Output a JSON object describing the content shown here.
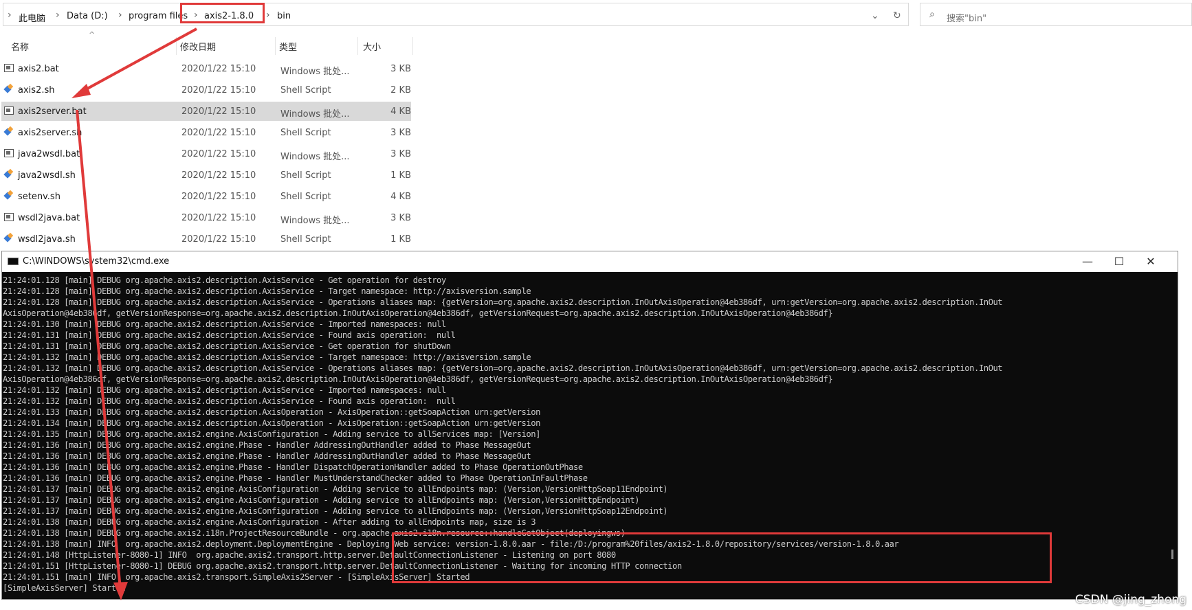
{
  "explorer": {
    "breadcrumb": [
      "此电脑",
      "Data (D:)",
      "program files",
      "axis2-1.8.0",
      "bin"
    ],
    "search_placeholder": "搜索\"bin\"",
    "columns": [
      "名称",
      "修改日期",
      "类型",
      "大小"
    ],
    "files": [
      {
        "name": "axis2.bat",
        "date": "2020/1/22 15:10",
        "type": "Windows 批处...",
        "size": "3 KB",
        "icon": "batch-file-icon",
        "selected": false
      },
      {
        "name": "axis2.sh",
        "date": "2020/1/22 15:10",
        "type": "Shell Script",
        "size": "2 KB",
        "icon": "shell-script-icon",
        "selected": false
      },
      {
        "name": "axis2server.bat",
        "date": "2020/1/22 15:10",
        "type": "Windows 批处...",
        "size": "4 KB",
        "icon": "batch-file-icon",
        "selected": true
      },
      {
        "name": "axis2server.sh",
        "date": "2020/1/22 15:10",
        "type": "Shell Script",
        "size": "3 KB",
        "icon": "shell-script-icon",
        "selected": false
      },
      {
        "name": "java2wsdl.bat",
        "date": "2020/1/22 15:10",
        "type": "Windows 批处...",
        "size": "3 KB",
        "icon": "batch-file-icon",
        "selected": false
      },
      {
        "name": "java2wsdl.sh",
        "date": "2020/1/22 15:10",
        "type": "Shell Script",
        "size": "1 KB",
        "icon": "shell-script-icon",
        "selected": false
      },
      {
        "name": "setenv.sh",
        "date": "2020/1/22 15:10",
        "type": "Shell Script",
        "size": "4 KB",
        "icon": "shell-script-icon",
        "selected": false
      },
      {
        "name": "wsdl2java.bat",
        "date": "2020/1/22 15:10",
        "type": "Windows 批处...",
        "size": "3 KB",
        "icon": "batch-file-icon",
        "selected": false
      },
      {
        "name": "wsdl2java.sh",
        "date": "2020/1/22 15:10",
        "type": "Shell Script",
        "size": "1 KB",
        "icon": "shell-script-icon",
        "selected": false
      }
    ]
  },
  "cmd": {
    "title": "C:\\WINDOWS\\system32\\cmd.exe",
    "lines": [
      "21:24:01.128 [main] DEBUG org.apache.axis2.description.AxisService - Get operation for destroy",
      "21:24:01.128 [main] DEBUG org.apache.axis2.description.AxisService - Target namespace: http://axisversion.sample",
      "21:24:01.128 [main] DEBUG org.apache.axis2.description.AxisService - Operations aliases map: {getVersion=org.apache.axis2.description.InOutAxisOperation@4eb386df, urn:getVersion=org.apache.axis2.description.InOut",
      "AxisOperation@4eb386df, getVersionResponse=org.apache.axis2.description.InOutAxisOperation@4eb386df, getVersionRequest=org.apache.axis2.description.InOutAxisOperation@4eb386df}",
      "21:24:01.130 [main] DEBUG org.apache.axis2.description.AxisService - Imported namespaces: null",
      "21:24:01.131 [main] DEBUG org.apache.axis2.description.AxisService - Found axis operation:  null",
      "21:24:01.131 [main] DEBUG org.apache.axis2.description.AxisService - Get operation for shutDown",
      "21:24:01.132 [main] DEBUG org.apache.axis2.description.AxisService - Target namespace: http://axisversion.sample",
      "21:24:01.132 [main] DEBUG org.apache.axis2.description.AxisService - Operations aliases map: {getVersion=org.apache.axis2.description.InOutAxisOperation@4eb386df, urn:getVersion=org.apache.axis2.description.InOut",
      "AxisOperation@4eb386df, getVersionResponse=org.apache.axis2.description.InOutAxisOperation@4eb386df, getVersionRequest=org.apache.axis2.description.InOutAxisOperation@4eb386df}",
      "21:24:01.132 [main] DEBUG org.apache.axis2.description.AxisService - Imported namespaces: null",
      "21:24:01.132 [main] DEBUG org.apache.axis2.description.AxisService - Found axis operation:  null",
      "21:24:01.133 [main] DEBUG org.apache.axis2.description.AxisOperation - AxisOperation::getSoapAction urn:getVersion",
      "21:24:01.134 [main] DEBUG org.apache.axis2.description.AxisOperation - AxisOperation::getSoapAction urn:getVersion",
      "21:24:01.135 [main] DEBUG org.apache.axis2.engine.AxisConfiguration - Adding service to allServices map: [Version]",
      "21:24:01.136 [main] DEBUG org.apache.axis2.engine.Phase - Handler AddressingOutHandler added to Phase MessageOut",
      "21:24:01.136 [main] DEBUG org.apache.axis2.engine.Phase - Handler AddressingOutHandler added to Phase MessageOut",
      "21:24:01.136 [main] DEBUG org.apache.axis2.engine.Phase - Handler DispatchOperationHandler added to Phase OperationOutPhase",
      "21:24:01.136 [main] DEBUG org.apache.axis2.engine.Phase - Handler MustUnderstandChecker added to Phase OperationInFaultPhase",
      "21:24:01.137 [main] DEBUG org.apache.axis2.engine.AxisConfiguration - Adding service to allEndpoints map: (Version,VersionHttpSoap11Endpoint)",
      "21:24:01.137 [main] DEBUG org.apache.axis2.engine.AxisConfiguration - Adding service to allEndpoints map: (Version,VersionHttpEndpoint)",
      "21:24:01.137 [main] DEBUG org.apache.axis2.engine.AxisConfiguration - Adding service to allEndpoints map: (Version,VersionHttpSoap12Endpoint)",
      "21:24:01.138 [main] DEBUG org.apache.axis2.engine.AxisConfiguration - After adding to allEndpoints map, size is 3",
      "21:24:01.138 [main] DEBUG org.apache.axis2.i18n.ProjectResourceBundle - org.apache.axis2.i18n.resource::handleGetObject(deployingws)",
      "21:24:01.138 [main] INFO  org.apache.axis2.deployment.DeploymentEngine - Deploying Web service: version-1.8.0.aar - file:/D:/program%20files/axis2-1.8.0/repository/services/version-1.8.0.aar",
      "21:24:01.148 [HttpListener-8080-1] INFO  org.apache.axis2.transport.http.server.DefaultConnectionListener - Listening on port 8080",
      "21:24:01.151 [HttpListener-8080-1] DEBUG org.apache.axis2.transport.http.server.DefaultConnectionListener - Waiting for incoming HTTP connection",
      "21:24:01.151 [main] INFO  org.apache.axis2.transport.SimpleAxis2Server - [SimpleAxisServer] Started",
      "[SimpleAxisServer] Started"
    ]
  },
  "watermark": "CSDN @jing_zhong",
  "colors": {
    "annotation_red": "#e03a3a",
    "console_bg": "#0c0c0c",
    "console_text": "#cccccc",
    "selected_row": "#d9d9d9"
  }
}
